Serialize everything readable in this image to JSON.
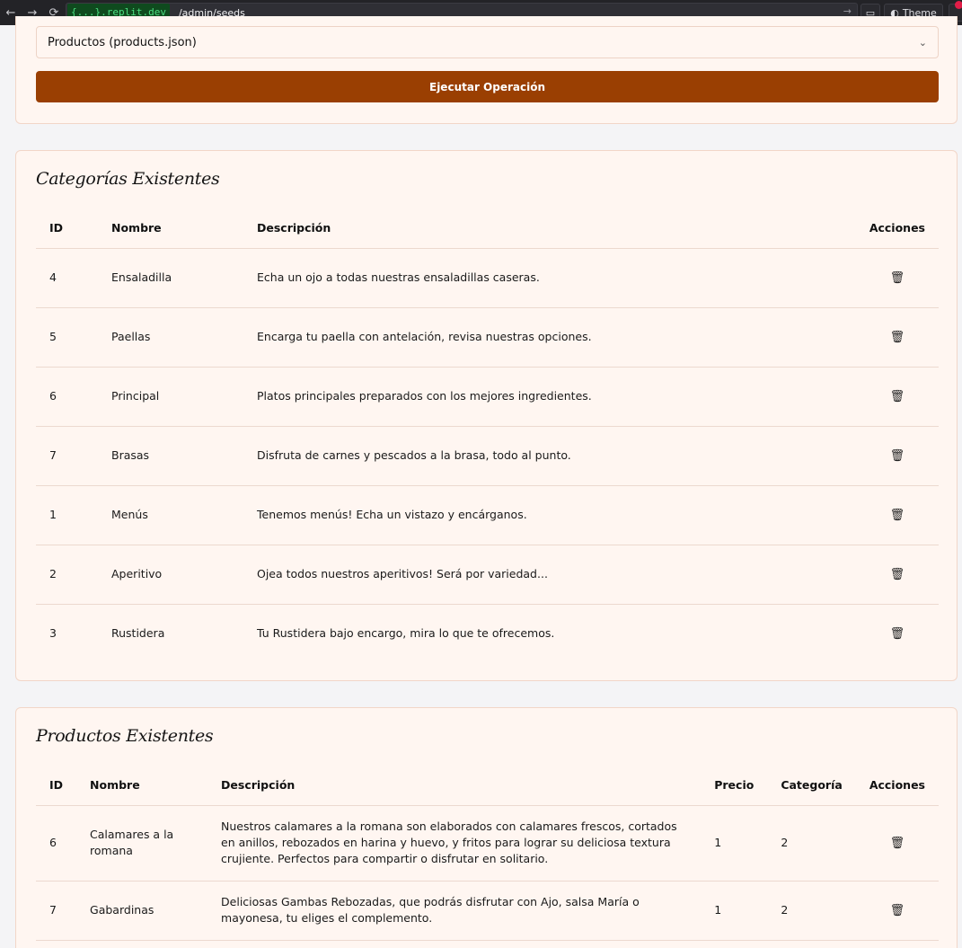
{
  "browser": {
    "back_icon": "←",
    "forward_icon": "→",
    "reload_icon": "⟳",
    "host_badge": "{...}.replit.dev",
    "path": "/admin/seeds",
    "go_icon": "→",
    "monitor_icon": "▭",
    "theme_icon": "◐",
    "theme_label": "Theme"
  },
  "seed_form": {
    "selected_option": "Productos (products.json)",
    "chevron": "⌄",
    "execute_label": "Ejecutar Operación"
  },
  "categories": {
    "title": "Categorías Existentes",
    "headers": {
      "id": "ID",
      "name": "Nombre",
      "description": "Descripción",
      "actions": "Acciones"
    },
    "rows": [
      {
        "id": "4",
        "name": "Ensaladilla",
        "description": "Echa un ojo a todas nuestras ensaladillas caseras."
      },
      {
        "id": "5",
        "name": "Paellas",
        "description": "Encarga tu paella con antelación, revisa nuestras opciones."
      },
      {
        "id": "6",
        "name": "Principal",
        "description": "Platos principales preparados con los mejores ingredientes."
      },
      {
        "id": "7",
        "name": "Brasas",
        "description": "Disfruta de carnes y pescados a la brasa, todo al punto."
      },
      {
        "id": "1",
        "name": "Menús",
        "description": "Tenemos menús! Echa un vistazo y encárganos."
      },
      {
        "id": "2",
        "name": "Aperitivo",
        "description": "Ojea todos nuestros aperitivos! Será por variedad..."
      },
      {
        "id": "3",
        "name": "Rustidera",
        "description": "Tu Rustidera bajo encargo, mira lo que te ofrecemos."
      }
    ]
  },
  "products": {
    "title": "Productos Existentes",
    "headers": {
      "id": "ID",
      "name": "Nombre",
      "description": "Descripción",
      "price": "Precio",
      "category": "Categoría",
      "actions": "Acciones"
    },
    "rows": [
      {
        "id": "6",
        "name": "Calamares a la romana",
        "description": "Nuestros calamares a la romana son elaborados con calamares frescos, cortados en anillos, rebozados en harina y huevo, y fritos para lograr su deliciosa textura crujiente. Perfectos para compartir o disfrutar en solitario.",
        "price": "1",
        "category": "2"
      },
      {
        "id": "7",
        "name": "Gabardinas",
        "description": "Deliciosas Gambas Rebozadas, que podrás disfrutar con Ajo, salsa María o mayonesa, tu eliges el complemento.",
        "price": "1",
        "category": "2"
      }
    ]
  },
  "icons": {
    "trash": "🗑"
  }
}
